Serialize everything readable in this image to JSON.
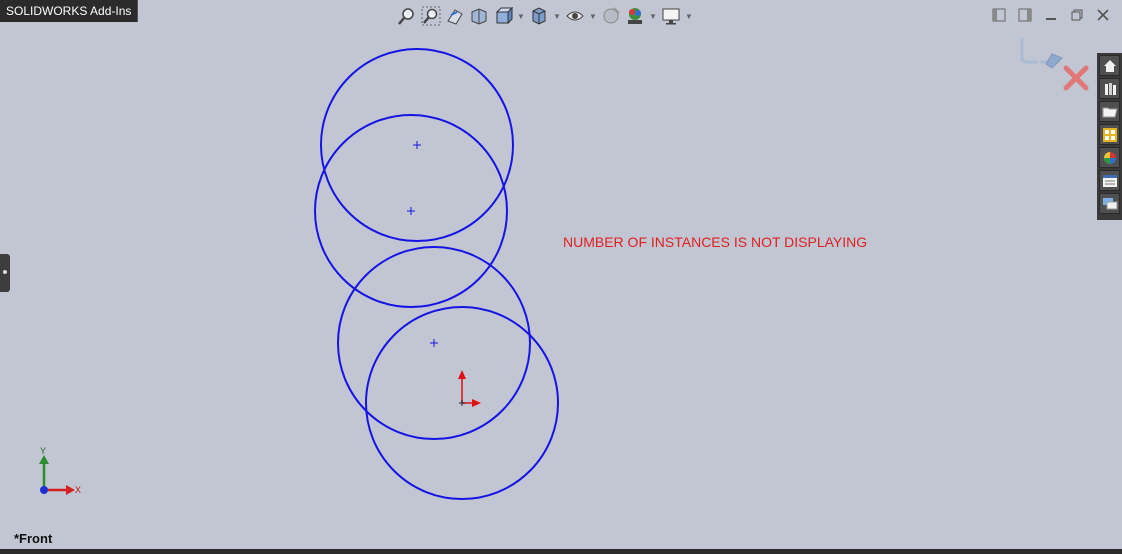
{
  "tab": {
    "label": "SOLIDWORKS Add-Ins"
  },
  "toolbar": {
    "icons": [
      "zoom-to-fit-icon",
      "zoom-to-area-icon",
      "previous-view-icon",
      "section-view-icon",
      "view-orientation-icon",
      "display-style-icon",
      "hide-show-items-icon",
      "edit-appearance-icon",
      "apply-scene-icon",
      "view-settings-icon"
    ]
  },
  "window_controls": [
    "tile-left-icon",
    "tile-right-icon",
    "minimize-icon",
    "restore-icon",
    "close-icon"
  ],
  "task_pane": [
    "solidworks-resources-icon",
    "design-library-icon",
    "file-explorer-icon",
    "view-palette-icon",
    "appearances-icon",
    "custom-properties-icon",
    "forum-icon"
  ],
  "annotation": {
    "text": "NUMBER OF INSTANCES IS NOT DISPLAYING"
  },
  "triad": {
    "y_label": "Y",
    "x_label": "X"
  },
  "view": {
    "name": "*Front"
  },
  "colors": {
    "sketch": "#1414e6",
    "annotation": "#e02020",
    "origin": "#e01010",
    "background": "#c2c6d2"
  }
}
